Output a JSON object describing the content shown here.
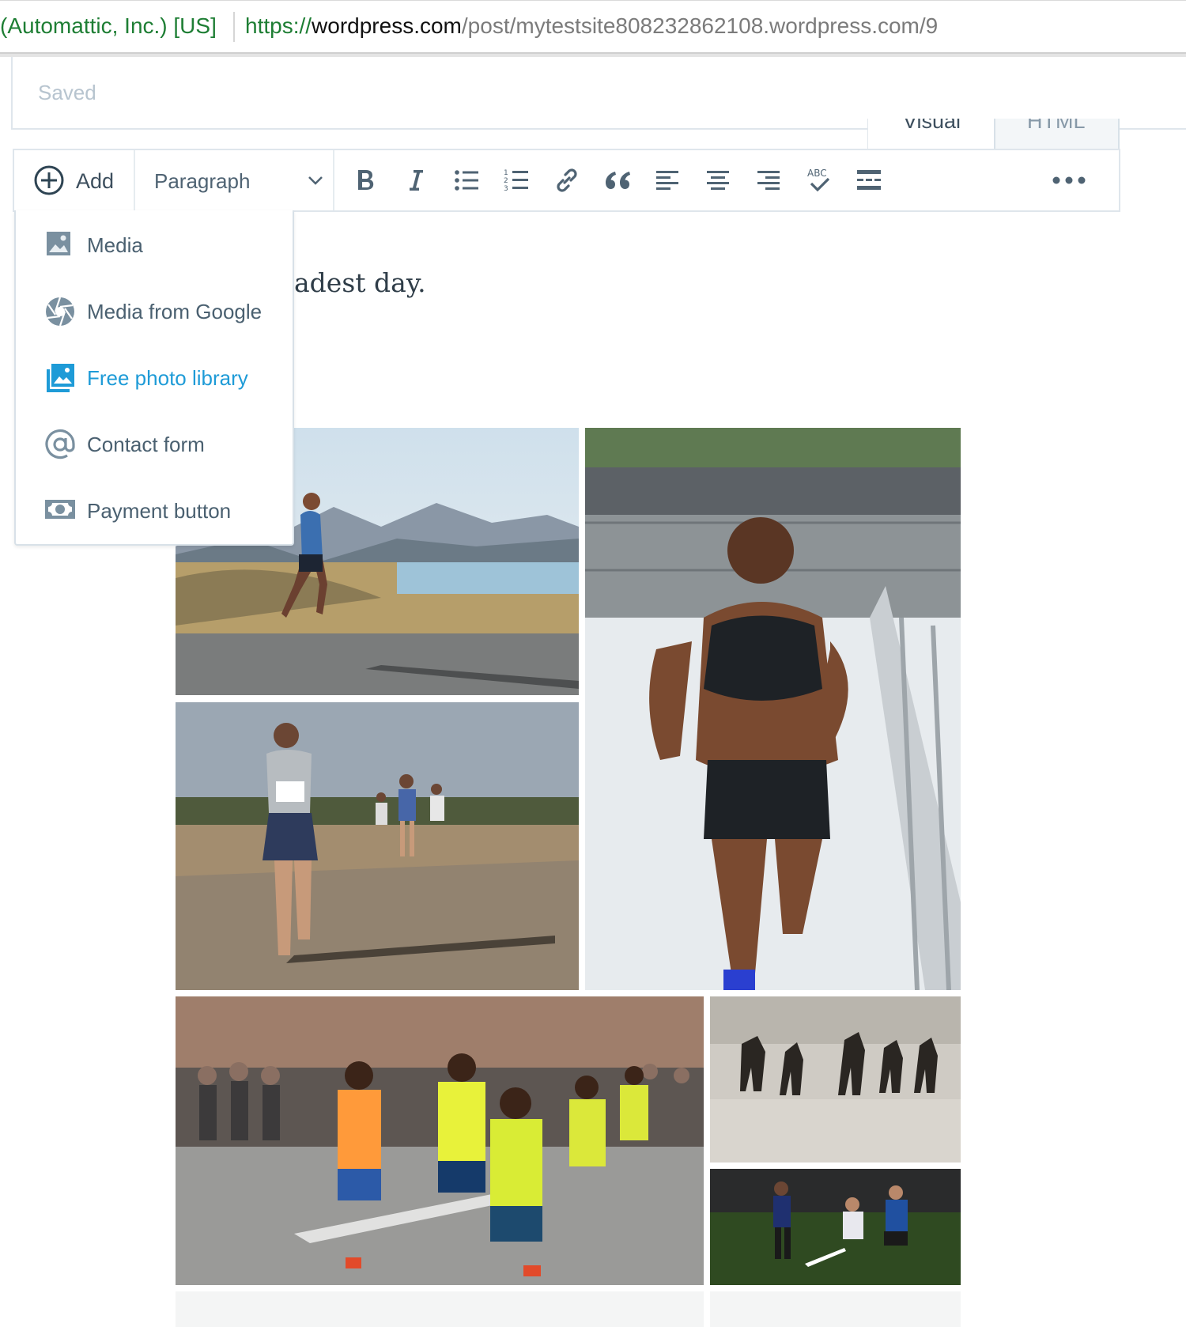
{
  "browser": {
    "org": "(Automattic, Inc.) [US]",
    "url_scheme": "https://",
    "url_host": "wordpress.com",
    "url_path": "/post/mytestsite808232862108.wordpress.com/9"
  },
  "editor": {
    "status": "Saved",
    "tabs": [
      "Visual",
      "HTML"
    ]
  },
  "toolbar": {
    "add_label": "Add",
    "format_value": "Paragraph",
    "buttons": [
      "bold-icon",
      "italic-icon",
      "bulleted-list-icon",
      "numbered-list-icon",
      "link-icon",
      "quote-icon",
      "align-left-icon",
      "align-center-icon",
      "align-right-icon",
      "spellcheck-icon",
      "read-more-icon",
      "more-icon"
    ],
    "spellcheck_text": "ABC",
    "numbered_list_glyphs": [
      "1",
      "2",
      "3"
    ]
  },
  "add_menu": {
    "items": [
      {
        "label": "Media",
        "icon": "image-icon"
      },
      {
        "label": "Media from Google",
        "icon": "aperture-icon"
      },
      {
        "label": "Free photo library",
        "icon": "photo-library-icon"
      },
      {
        "label": "Contact form",
        "icon": "at-icon"
      },
      {
        "label": "Payment button",
        "icon": "money-icon"
      }
    ],
    "active_color": "#1e9bd7"
  },
  "content": {
    "visible_text": "adest day."
  },
  "gallery": {
    "images": [
      {
        "subject": "runner on coastal road"
      },
      {
        "subject": "sprinter on track"
      },
      {
        "subject": "marathon runner on road"
      },
      {
        "subject": "marathon pack in town"
      },
      {
        "subject": "horses racing on beach"
      },
      {
        "subject": "field hockey players"
      }
    ]
  }
}
